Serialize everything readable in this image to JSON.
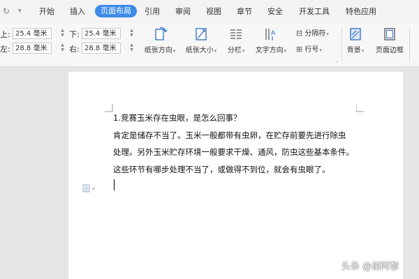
{
  "quick_access": {
    "redo_icon": "redo-icon",
    "more_icon": "chevron-down-icon"
  },
  "tabs": [
    {
      "label": "开始"
    },
    {
      "label": "插入"
    },
    {
      "label": "页面布局",
      "active": true
    },
    {
      "label": "引用"
    },
    {
      "label": "审阅"
    },
    {
      "label": "视图"
    },
    {
      "label": "章节"
    },
    {
      "label": "安全"
    },
    {
      "label": "开发工具"
    },
    {
      "label": "特色应用"
    }
  ],
  "margins": {
    "top_label": "上:",
    "top_value": "25.4 毫米",
    "left_label": "左:",
    "left_value": "28.8 毫米",
    "bottom_label": "下:",
    "bottom_value": "25.4 毫米",
    "right_label": "右:",
    "right_value": "28.8 毫米"
  },
  "ribbon": {
    "orientation": "纸张方向",
    "size": "纸张大小",
    "columns": "分栏",
    "text_direction": "文字方向",
    "separator": "分隔符",
    "line_numbers": "行号",
    "background": "背景",
    "page_border": "页面边框"
  },
  "document": {
    "lines": [
      "1.竞赛玉米存在虫眼，是怎么回事？",
      "肯定是储存不当了。玉米一般都带有虫卵，在贮存前要先进行除虫",
      "处理。另外玉米贮存环境一般要求干燥、通风，防虫这些基本条件。",
      "这些环节有哪步处理不当了，或做得不到位，就会有虫眼了。"
    ]
  },
  "watermark": "头条 @谢阿黎",
  "colors": {
    "accent": "#3d8ae8",
    "ribbon_bg": "#f7f7f7",
    "canvas_bg": "#e5e5e5"
  }
}
